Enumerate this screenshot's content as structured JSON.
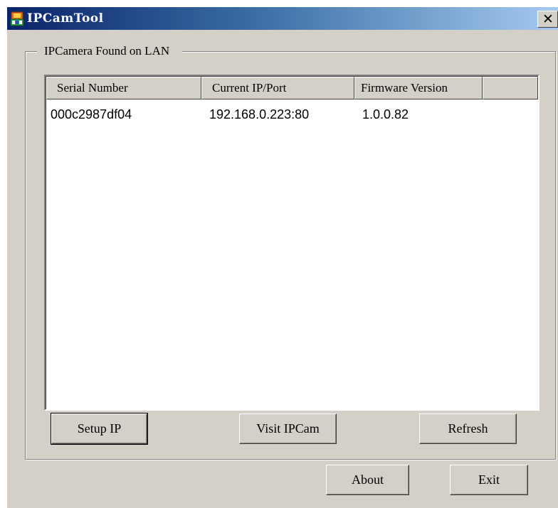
{
  "window": {
    "title": "IPCamTool"
  },
  "group": {
    "label": "IPCamera Found on LAN"
  },
  "table": {
    "columns": [
      "Serial Number",
      "Current IP/Port",
      "Firmware Version"
    ],
    "rows": [
      {
        "serial": "000c2987df04",
        "ip_port": "192.168.0.223:80",
        "firmware": "1.0.0.82"
      }
    ]
  },
  "buttons": {
    "setup_ip": "Setup IP",
    "visit_ipcam": "Visit IPCam",
    "refresh": "Refresh",
    "about": "About",
    "exit": "Exit"
  },
  "icons": {
    "app": "ipcamtool-app-icon",
    "close": "close-icon"
  },
  "colors": {
    "titlebar_start": "#0a246a",
    "titlebar_end": "#a6caf0",
    "face": "#d4d0c8"
  }
}
